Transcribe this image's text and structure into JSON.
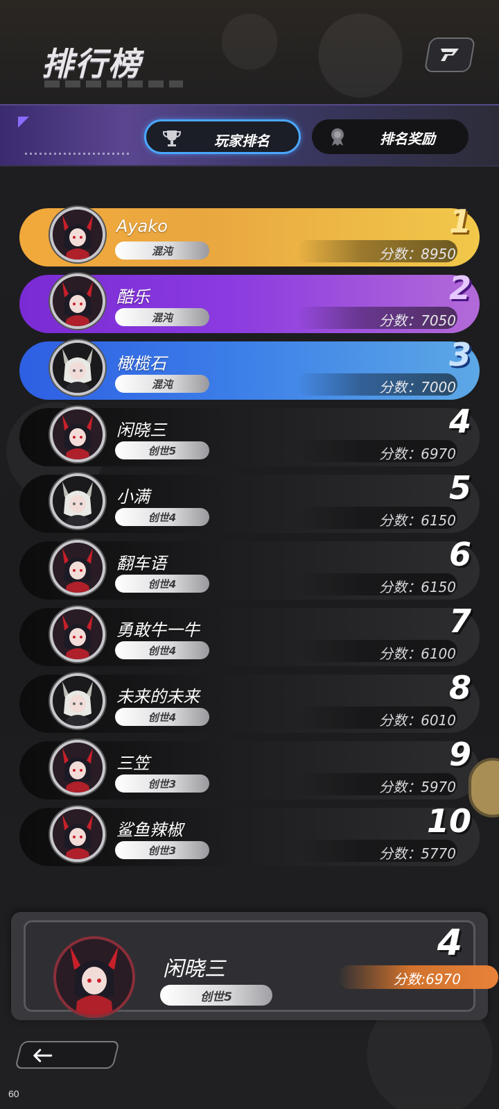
{
  "header": {
    "title": "排行榜",
    "settings_icon": "logo-badge-icon"
  },
  "tabs": [
    {
      "label": "玩家排名",
      "icon": "trophy-icon",
      "active": true
    },
    {
      "label": "排名奖励",
      "icon": "medal-icon",
      "active": false
    }
  ],
  "leaderboard": [
    {
      "rank": "1",
      "name": "Ayako",
      "tier": "混沌",
      "score": "分数：8950",
      "style": "gold",
      "avatar": "dark"
    },
    {
      "rank": "2",
      "name": "酷乐",
      "tier": "混沌",
      "score": "分数：7050",
      "style": "purple",
      "avatar": "dark"
    },
    {
      "rank": "3",
      "name": "橄榄石",
      "tier": "混沌",
      "score": "分数：7000",
      "style": "blue",
      "avatar": "light"
    },
    {
      "rank": "4",
      "name": "闲晓三",
      "tier": "创世5",
      "score": "分数：6970",
      "style": "dark",
      "avatar": "dark"
    },
    {
      "rank": "5",
      "name": "小满",
      "tier": "创世4",
      "score": "分数：6150",
      "style": "dark",
      "avatar": "light"
    },
    {
      "rank": "6",
      "name": "翻车语",
      "tier": "创世4",
      "score": "分数：6150",
      "style": "dark",
      "avatar": "dark"
    },
    {
      "rank": "7",
      "name": "勇敢牛一牛",
      "tier": "创世4",
      "score": "分数：6100",
      "style": "dark",
      "avatar": "dark"
    },
    {
      "rank": "8",
      "name": "未来的未来",
      "tier": "创世4",
      "score": "分数：6010",
      "style": "dark",
      "avatar": "light"
    },
    {
      "rank": "9",
      "name": "三笠",
      "tier": "创世3",
      "score": "分数：5970",
      "style": "dark",
      "avatar": "dark"
    },
    {
      "rank": "10",
      "name": "鲨鱼辣椒",
      "tier": "创世3",
      "score": "分数：5770",
      "style": "dark",
      "avatar": "dark"
    }
  ],
  "self": {
    "rank": "4",
    "name": "闲晓三",
    "tier": "创世5",
    "score": "分数:6970"
  },
  "footer": {
    "back_icon": "arrow-left-icon",
    "fps": "60"
  },
  "colors": {
    "accent_blue": "#4aa7ff",
    "gold": "#f2a93b",
    "purple": "#7a2bd3",
    "blue": "#2e5fe3",
    "self_score": "#e8823a"
  }
}
